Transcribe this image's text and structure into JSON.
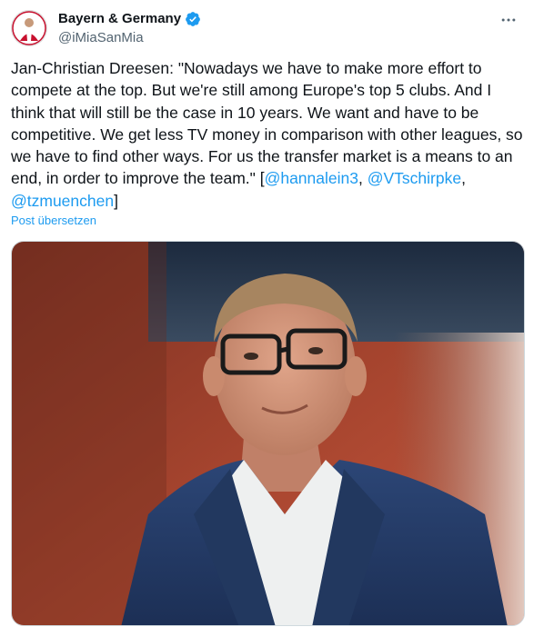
{
  "author": {
    "display_name": "Bayern & Germany",
    "handle": "@iMiaSanMia",
    "verified": true,
    "verified_color": "#1d9bf0"
  },
  "tweet": {
    "text_parts": [
      "Jan-Christian Dreesen: \"Nowadays we have to make more effort to compete at the top. But we're still among Europe's top 5 clubs. And I think that will still be the case in 10 years. We want and have to be competitive. We get less TV money in comparison with other leagues, so we have to find other ways. For us the transfer market is a means to an end, in order to improve the team.\" [",
      "@hannalein3",
      ", ",
      "@VTschirpke",
      ", ",
      "@tzmuenchen",
      "]"
    ],
    "translate_label": "Post übersetzen"
  },
  "icons": {
    "more": "more-options-icon",
    "verified": "verified-badge-icon"
  },
  "colors": {
    "link": "#1d9bf0",
    "secondary_text": "#536471",
    "primary_text": "#0f1419"
  }
}
